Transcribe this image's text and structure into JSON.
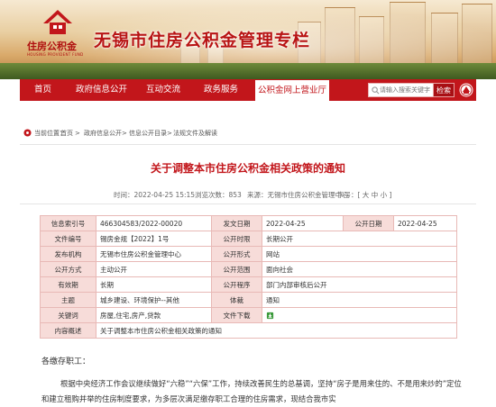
{
  "header": {
    "logo_text": "住房公积金",
    "logo_en": "HOUSING PROVIDENT FUND",
    "site_title": "无锡市住房公积金管理专栏"
  },
  "nav": {
    "items": [
      "首页",
      "政府信息公开",
      "互动交流",
      "政务服务",
      "公积金网上营业厅"
    ],
    "active_index": 4,
    "search_placeholder": "请输入搜索关键字",
    "search_button": "检索"
  },
  "breadcrumb": {
    "items": [
      "当前位置：",
      "首页",
      "政府信息公开",
      "信息公开目录",
      "法规文件及解读"
    ],
    "separator": ">"
  },
  "article": {
    "title": "关于调整本市住房公积金相关政策的通知",
    "time": "时间：2022-04-25 15:15",
    "views": "浏览次数：853",
    "source": "来源：无锡市住房公积金管理中心",
    "font_size": "字号：[ 大 中 小 ]"
  },
  "info_table": {
    "rows": [
      [
        {
          "k": "信息索引号",
          "v": "466304583/2022-00020"
        },
        {
          "k": "发文日期",
          "v": "2022-04-25"
        },
        {
          "k": "公开日期",
          "v": "2022-04-25"
        }
      ],
      [
        {
          "k": "文件编号",
          "v": "锡房金规【2022】1号"
        },
        {
          "k": "公开时限",
          "v": "长期公开"
        }
      ],
      [
        {
          "k": "发布机构",
          "v": "无锡市住房公积金管理中心"
        },
        {
          "k": "公开形式",
          "v": "网站"
        }
      ],
      [
        {
          "k": "公开方式",
          "v": "主动公开"
        },
        {
          "k": "公开范围",
          "v": "面向社会"
        }
      ],
      [
        {
          "k": "有效期",
          "v": "长期"
        },
        {
          "k": "公开程序",
          "v": "部门内部审核后公开"
        }
      ],
      [
        {
          "k": "主题",
          "v": "城乡建设、环境保护--其他"
        },
        {
          "k": "体裁",
          "v": "通知"
        }
      ],
      [
        {
          "k": "关键词",
          "v": "房屋,住宅,房产,贷款"
        },
        {
          "k": "文件下载",
          "v": ""
        }
      ],
      [
        {
          "k": "内容概述",
          "v": "关于调整本市住房公积金相关政策的通知"
        }
      ]
    ]
  },
  "body": {
    "greeting": "各缴存职工：",
    "paragraph": "根据中央经济工作会议继续做好“六稳”“六保”工作，持续改善民生的总基调，坚持“房子是用来住的、不是用来炒的”定位和建立租购并举的住房制度要求，为多层次满足缴存职工合理的住房需求，现结合我市实"
  },
  "colors": {
    "brand_red": "#c2161b",
    "table_key_bg": "#f7dcd9",
    "table_border": "#e8b9b6"
  }
}
